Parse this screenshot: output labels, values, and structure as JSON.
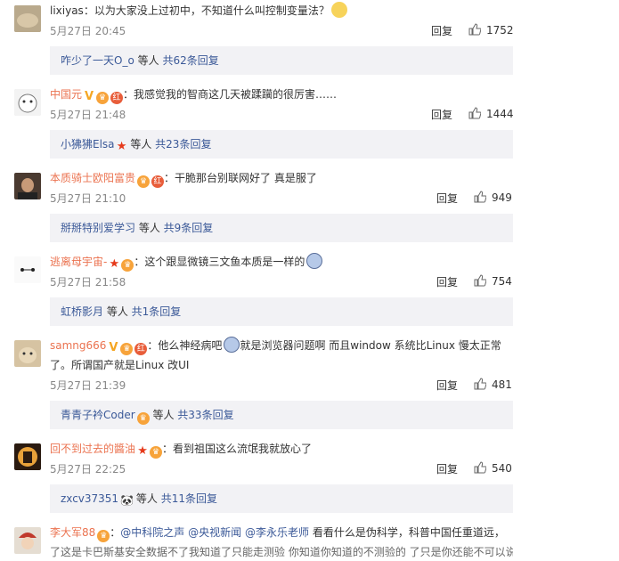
{
  "comments": [
    {
      "user": "lixiyas",
      "text": "：以为大家没上过初中，不知道什么叫控制变量法？",
      "time": "5月27日 20:45",
      "reply_label": "回复",
      "likes": "1752",
      "sub_user": "咋少了一天O_o",
      "sub_mid": " 等人 ",
      "sub_count": "共62条回复",
      "avatar_color": "#c4b49a"
    },
    {
      "user": "中国元",
      "text": "：我感觉我的智商这几天被蹂躏的很厉害……",
      "time": "5月27日 21:48",
      "reply_label": "回复",
      "likes": "1444",
      "sub_user": "小狒狒Elsa",
      "sub_mid": " 等人 ",
      "sub_count": "共23条回复",
      "avatar_color": "#e9e9e9"
    },
    {
      "user": "本质骑士欧阳富贵",
      "text": "：干脆那台别联网好了 真是服了",
      "time": "5月27日 21:10",
      "reply_label": "回复",
      "likes": "949",
      "sub_user": "掰掰特别爱学习",
      "sub_mid": " 等人 ",
      "sub_count": "共9条回复",
      "avatar_color": "#5a4a3e"
    },
    {
      "user": "逃离母宇宙-",
      "text": "：这个跟显微镜三文鱼本质是一样的",
      "time": "5月27日 21:58",
      "reply_label": "回复",
      "likes": "754",
      "sub_user": "虹桥影月",
      "sub_mid": " 等人 ",
      "sub_count": "共1条回复",
      "avatar_color": "#f4f4f4"
    },
    {
      "user": "samng666",
      "text1": "：他么神经病吧",
      "text2": "就是浏览器问题啊 而且window 系统比Linux 慢太正常",
      "text3": "了。所谓国产就是Linux 改UI",
      "time": "5月27日 21:39",
      "reply_label": "回复",
      "likes": "481",
      "sub_user": "青青子衿Coder",
      "sub_mid": " 等人 ",
      "sub_count": "共33条回复",
      "avatar_color": "#c7b190"
    },
    {
      "user": "回不到过去的醬油",
      "text": "：看到祖国这么流氓我就放心了",
      "time": "5月27日 22:25",
      "reply_label": "回复",
      "likes": "540",
      "sub_user": "zxcv37351",
      "sub_mid": " 等人 ",
      "sub_count": "共11条回复",
      "avatar_color": "#3a2a1e"
    },
    {
      "user": "李大军88",
      "text_a": "：",
      "topic1": "@中科院之声",
      "topic2": "@央视新闻",
      "topic3": "@李永乐老师",
      "text_b": " 看看什么是伪科学，科普中国任重道远，",
      "text_c": "了这是卡巴斯基安全数据不了我知道了只能走测验 你知道你知道的不测验的 了只是你还能不可以说的测",
      "avatar_color": "#d9d0c5"
    }
  ],
  "colors": {
    "accent": "#eb7350",
    "link": "#3b5998",
    "sub_bg": "#f2f2f5"
  }
}
